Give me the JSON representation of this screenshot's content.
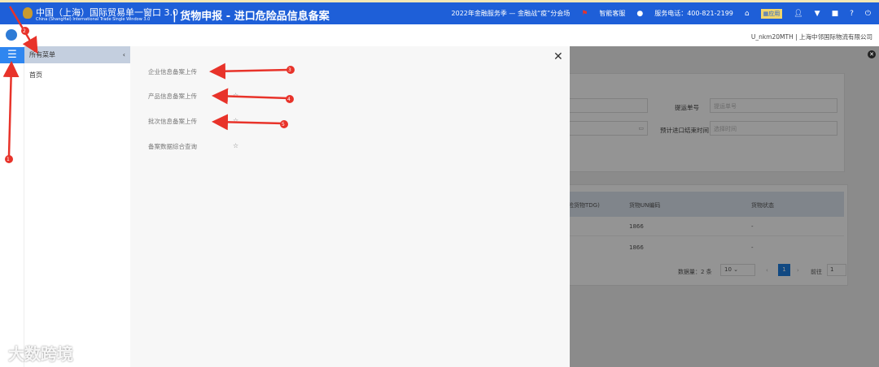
{
  "topbar": {
    "brand_cn": "中国（上海）国际贸易单一窗口 3.0",
    "brand_en": "China (ShangHai) International Trade Single Window 3.0",
    "title": "| 货物申报 - 进口危险品信息备案",
    "promo": "2022年金融服务季 — 金融战“疫”分会场",
    "smart_service": "智能客服",
    "hotline": "服务电话：400-821-2199",
    "apps": "应用"
  },
  "user": {
    "info": "U_nkm20MTH | 上海中邻国际物流有限公司"
  },
  "menu": {
    "header": "所有菜单",
    "items": [
      {
        "label": "首页"
      }
    ]
  },
  "submenu": {
    "items": [
      {
        "label": "企业信息备案上传"
      },
      {
        "label": "产品信息备案上传"
      },
      {
        "label": "批次信息备案上传"
      },
      {
        "label": "备案数据综合查询"
      }
    ]
  },
  "background_page": {
    "field1_label": "提运单号",
    "field1_placeholder": "提运单号",
    "field2_label": "预计进口结束时间",
    "field2_placeholder": "选择时间",
    "columns": [
      "危险货物TDG)",
      "货物UN编码",
      "货物状态"
    ],
    "rows": [
      {
        "un": "1866",
        "status": "-"
      },
      {
        "un": "1866",
        "status": "-"
      }
    ],
    "total": "数据量：2 条",
    "page_size": "10",
    "current_page": "1",
    "goto_label": "前往",
    "goto_value": "1"
  },
  "annotations": [
    "1",
    "2",
    "3",
    "4",
    "5"
  ],
  "watermark": "大数跨境",
  "colors": {
    "primary": "#1e5fd8",
    "annotation": "#e8332a"
  }
}
